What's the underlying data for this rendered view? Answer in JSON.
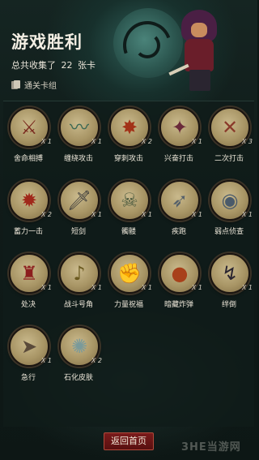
{
  "header": {
    "title": "游戏胜利",
    "summary_prefix": "总共收集了",
    "summary_count": "22",
    "summary_suffix": "张卡",
    "deck_label": "通关卡组"
  },
  "cards": [
    {
      "name": "舍命相搏",
      "qty": "X 1",
      "icon": "warrior-icon",
      "color": "#7a2a1e",
      "glyph": "⚔"
    },
    {
      "name": "缠绕攻击",
      "qty": "X 1",
      "icon": "vine-icon",
      "color": "#3d6a55",
      "glyph": "〰"
    },
    {
      "name": "穿刺攻击",
      "qty": "X 2",
      "icon": "spike-burst-icon",
      "color": "#a23218",
      "glyph": "✸"
    },
    {
      "name": "兴奋打击",
      "qty": "X 1",
      "icon": "rage-hero-icon",
      "color": "#6a2a3a",
      "glyph": "✦"
    },
    {
      "name": "二次打击",
      "qty": "X 3",
      "icon": "twin-strike-icon",
      "color": "#8a3a2a",
      "glyph": "✕"
    },
    {
      "name": "蓄力一击",
      "qty": "X 2",
      "icon": "hammer-icon",
      "color": "#a0281a",
      "glyph": "✹"
    },
    {
      "name": "短剑",
      "qty": "X 1",
      "icon": "dagger-icon",
      "color": "#3a3a3a",
      "glyph": "🗡"
    },
    {
      "name": "髑髅",
      "qty": "X 1",
      "icon": "skull-icon",
      "color": "#4c5a3e",
      "glyph": "☠"
    },
    {
      "name": "疾跑",
      "qty": "X 1",
      "icon": "wolf-run-icon",
      "color": "#55606a",
      "glyph": "➶"
    },
    {
      "name": "弱点侦查",
      "qty": "X 1",
      "icon": "werewolf-icon",
      "color": "#4a5a6a",
      "glyph": "◉"
    },
    {
      "name": "处决",
      "qty": "X 1",
      "icon": "executioner-icon",
      "color": "#8c1e1e",
      "glyph": "♜"
    },
    {
      "name": "战斗号角",
      "qty": "X 1",
      "icon": "war-horn-icon",
      "color": "#6b5a20",
      "glyph": "♪"
    },
    {
      "name": "力量祝福",
      "qty": "X 1",
      "icon": "fist-icon",
      "color": "#7a5a3a",
      "glyph": "✊"
    },
    {
      "name": "暗藏炸弹",
      "qty": "X 1",
      "icon": "bomb-icon",
      "color": "#a8401a",
      "glyph": "●"
    },
    {
      "name": "绊倒",
      "qty": "X 1",
      "icon": "trip-icon",
      "color": "#2a2530",
      "glyph": "↯"
    },
    {
      "name": "急行",
      "qty": "X 1",
      "icon": "runner-icon",
      "color": "#5a4a3a",
      "glyph": "➤"
    },
    {
      "name": "石化皮肤",
      "qty": "X 2",
      "icon": "shield-crack-icon",
      "color": "#7a9a9a",
      "glyph": "✺"
    }
  ],
  "footer": {
    "home_button": "返回首页",
    "watermark": "3HE当游网"
  }
}
